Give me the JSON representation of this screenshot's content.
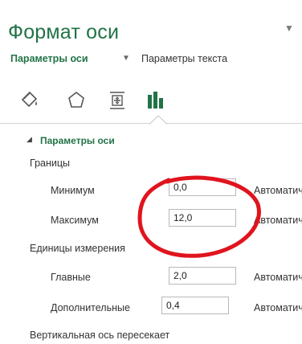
{
  "pane": {
    "title": "Формат оси",
    "menu_icon": "chevron-down-icon"
  },
  "tabs": {
    "axis_options": "Параметры оси",
    "text_options": "Параметры текста"
  },
  "icon_row": {
    "fill": "paint-bucket-icon",
    "effects": "pentagon-icon",
    "size_properties": "size-properties-icon",
    "axis_options": "bar-chart-icon"
  },
  "section": {
    "title": "Параметры оси",
    "bounds_label": "Границы",
    "minimum_label": "Минимум",
    "minimum_value": "0,0",
    "minimum_reset": "Автоматически",
    "maximum_label": "Максимум",
    "maximum_value": "12,0",
    "maximum_reset": "Автоматически",
    "units_label": "Единицы измерения",
    "major_label": "Главные",
    "major_value": "2,0",
    "major_reset": "Автоматически",
    "minor_label": "Дополнительные",
    "minor_value": "0,4",
    "minor_reset": "Автоматически",
    "crosses_label": "Вертикальная ось пересекает"
  },
  "colors": {
    "accent": "#217346",
    "annotation": "#e0141e"
  }
}
